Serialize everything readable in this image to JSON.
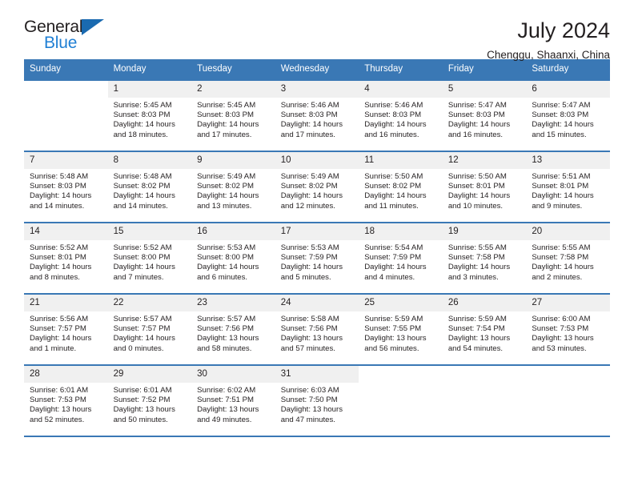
{
  "brand": {
    "name_top": "General",
    "name_bottom": "Blue",
    "logo_icon": "blue-triangle-icon",
    "accent_color": "#1f7fd4"
  },
  "header": {
    "title": "July 2024",
    "location": "Chenggu, Shaanxi, China"
  },
  "calendar": {
    "header_color": "#3a78b5",
    "date_strip_color": "#f0f0f0",
    "day_names": [
      "Sunday",
      "Monday",
      "Tuesday",
      "Wednesday",
      "Thursday",
      "Friday",
      "Saturday"
    ],
    "weeks": [
      [
        {
          "date": "",
          "lines": []
        },
        {
          "date": "1",
          "lines": [
            "Sunrise: 5:45 AM",
            "Sunset: 8:03 PM",
            "Daylight: 14 hours",
            "and 18 minutes."
          ]
        },
        {
          "date": "2",
          "lines": [
            "Sunrise: 5:45 AM",
            "Sunset: 8:03 PM",
            "Daylight: 14 hours",
            "and 17 minutes."
          ]
        },
        {
          "date": "3",
          "lines": [
            "Sunrise: 5:46 AM",
            "Sunset: 8:03 PM",
            "Daylight: 14 hours",
            "and 17 minutes."
          ]
        },
        {
          "date": "4",
          "lines": [
            "Sunrise: 5:46 AM",
            "Sunset: 8:03 PM",
            "Daylight: 14 hours",
            "and 16 minutes."
          ]
        },
        {
          "date": "5",
          "lines": [
            "Sunrise: 5:47 AM",
            "Sunset: 8:03 PM",
            "Daylight: 14 hours",
            "and 16 minutes."
          ]
        },
        {
          "date": "6",
          "lines": [
            "Sunrise: 5:47 AM",
            "Sunset: 8:03 PM",
            "Daylight: 14 hours",
            "and 15 minutes."
          ]
        }
      ],
      [
        {
          "date": "7",
          "lines": [
            "Sunrise: 5:48 AM",
            "Sunset: 8:03 PM",
            "Daylight: 14 hours",
            "and 14 minutes."
          ]
        },
        {
          "date": "8",
          "lines": [
            "Sunrise: 5:48 AM",
            "Sunset: 8:02 PM",
            "Daylight: 14 hours",
            "and 14 minutes."
          ]
        },
        {
          "date": "9",
          "lines": [
            "Sunrise: 5:49 AM",
            "Sunset: 8:02 PM",
            "Daylight: 14 hours",
            "and 13 minutes."
          ]
        },
        {
          "date": "10",
          "lines": [
            "Sunrise: 5:49 AM",
            "Sunset: 8:02 PM",
            "Daylight: 14 hours",
            "and 12 minutes."
          ]
        },
        {
          "date": "11",
          "lines": [
            "Sunrise: 5:50 AM",
            "Sunset: 8:02 PM",
            "Daylight: 14 hours",
            "and 11 minutes."
          ]
        },
        {
          "date": "12",
          "lines": [
            "Sunrise: 5:50 AM",
            "Sunset: 8:01 PM",
            "Daylight: 14 hours",
            "and 10 minutes."
          ]
        },
        {
          "date": "13",
          "lines": [
            "Sunrise: 5:51 AM",
            "Sunset: 8:01 PM",
            "Daylight: 14 hours",
            "and 9 minutes."
          ]
        }
      ],
      [
        {
          "date": "14",
          "lines": [
            "Sunrise: 5:52 AM",
            "Sunset: 8:01 PM",
            "Daylight: 14 hours",
            "and 8 minutes."
          ]
        },
        {
          "date": "15",
          "lines": [
            "Sunrise: 5:52 AM",
            "Sunset: 8:00 PM",
            "Daylight: 14 hours",
            "and 7 minutes."
          ]
        },
        {
          "date": "16",
          "lines": [
            "Sunrise: 5:53 AM",
            "Sunset: 8:00 PM",
            "Daylight: 14 hours",
            "and 6 minutes."
          ]
        },
        {
          "date": "17",
          "lines": [
            "Sunrise: 5:53 AM",
            "Sunset: 7:59 PM",
            "Daylight: 14 hours",
            "and 5 minutes."
          ]
        },
        {
          "date": "18",
          "lines": [
            "Sunrise: 5:54 AM",
            "Sunset: 7:59 PM",
            "Daylight: 14 hours",
            "and 4 minutes."
          ]
        },
        {
          "date": "19",
          "lines": [
            "Sunrise: 5:55 AM",
            "Sunset: 7:58 PM",
            "Daylight: 14 hours",
            "and 3 minutes."
          ]
        },
        {
          "date": "20",
          "lines": [
            "Sunrise: 5:55 AM",
            "Sunset: 7:58 PM",
            "Daylight: 14 hours",
            "and 2 minutes."
          ]
        }
      ],
      [
        {
          "date": "21",
          "lines": [
            "Sunrise: 5:56 AM",
            "Sunset: 7:57 PM",
            "Daylight: 14 hours",
            "and 1 minute."
          ]
        },
        {
          "date": "22",
          "lines": [
            "Sunrise: 5:57 AM",
            "Sunset: 7:57 PM",
            "Daylight: 14 hours",
            "and 0 minutes."
          ]
        },
        {
          "date": "23",
          "lines": [
            "Sunrise: 5:57 AM",
            "Sunset: 7:56 PM",
            "Daylight: 13 hours",
            "and 58 minutes."
          ]
        },
        {
          "date": "24",
          "lines": [
            "Sunrise: 5:58 AM",
            "Sunset: 7:56 PM",
            "Daylight: 13 hours",
            "and 57 minutes."
          ]
        },
        {
          "date": "25",
          "lines": [
            "Sunrise: 5:59 AM",
            "Sunset: 7:55 PM",
            "Daylight: 13 hours",
            "and 56 minutes."
          ]
        },
        {
          "date": "26",
          "lines": [
            "Sunrise: 5:59 AM",
            "Sunset: 7:54 PM",
            "Daylight: 13 hours",
            "and 54 minutes."
          ]
        },
        {
          "date": "27",
          "lines": [
            "Sunrise: 6:00 AM",
            "Sunset: 7:53 PM",
            "Daylight: 13 hours",
            "and 53 minutes."
          ]
        }
      ],
      [
        {
          "date": "28",
          "lines": [
            "Sunrise: 6:01 AM",
            "Sunset: 7:53 PM",
            "Daylight: 13 hours",
            "and 52 minutes."
          ]
        },
        {
          "date": "29",
          "lines": [
            "Sunrise: 6:01 AM",
            "Sunset: 7:52 PM",
            "Daylight: 13 hours",
            "and 50 minutes."
          ]
        },
        {
          "date": "30",
          "lines": [
            "Sunrise: 6:02 AM",
            "Sunset: 7:51 PM",
            "Daylight: 13 hours",
            "and 49 minutes."
          ]
        },
        {
          "date": "31",
          "lines": [
            "Sunrise: 6:03 AM",
            "Sunset: 7:50 PM",
            "Daylight: 13 hours",
            "and 47 minutes."
          ]
        },
        {
          "date": "",
          "lines": []
        },
        {
          "date": "",
          "lines": []
        },
        {
          "date": "",
          "lines": []
        }
      ]
    ]
  }
}
